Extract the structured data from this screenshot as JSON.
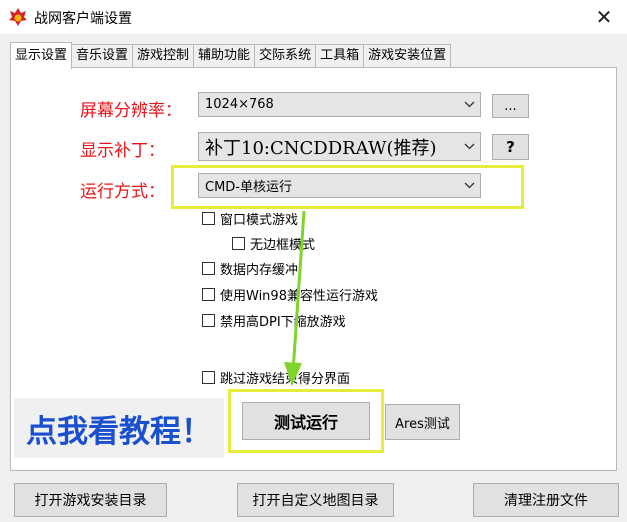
{
  "window": {
    "title": "战网客户端设置",
    "close": "✕"
  },
  "tabs": [
    "显示设置",
    "音乐设置",
    "游戏控制",
    "辅助功能",
    "交际系统",
    "工具箱",
    "游戏安装位置"
  ],
  "display": {
    "resolution": {
      "label": "屏幕分辨率：",
      "value": "1024×768",
      "more": "..."
    },
    "patch": {
      "label": "显示补丁：",
      "value": "补丁10:CNCDDRAW(推荐)",
      "help": "?"
    },
    "run_mode": {
      "label": "运行方式：",
      "value": "CMD-单核运行"
    }
  },
  "checkboxes": {
    "window_mode": "窗口模式游戏",
    "borderless": "无边框模式",
    "data_cache": "数据内存缓冲",
    "win98": "使用Win98兼容性运行游戏",
    "disable_dpi": "禁用高DPI下缩放游戏",
    "skip_score": "跳过游戏结束得分界面"
  },
  "actions": {
    "tutorial": "点我看教程！",
    "test_run": "测试运行",
    "ares_test": "Ares测试"
  },
  "bottom": {
    "open_install": "打开游戏安装目录",
    "open_maps": "打开自定义地图目录",
    "clean_reg": "清理注册文件"
  },
  "colors": {
    "label_red": "#e8161b",
    "highlight": "#e6ec3a",
    "arrow": "#7fd32a",
    "tutorial_blue": "#1a4fd0"
  },
  "icons": {
    "app": "flame-icon",
    "close": "close-icon",
    "dropdown": "chevron-down-icon"
  }
}
